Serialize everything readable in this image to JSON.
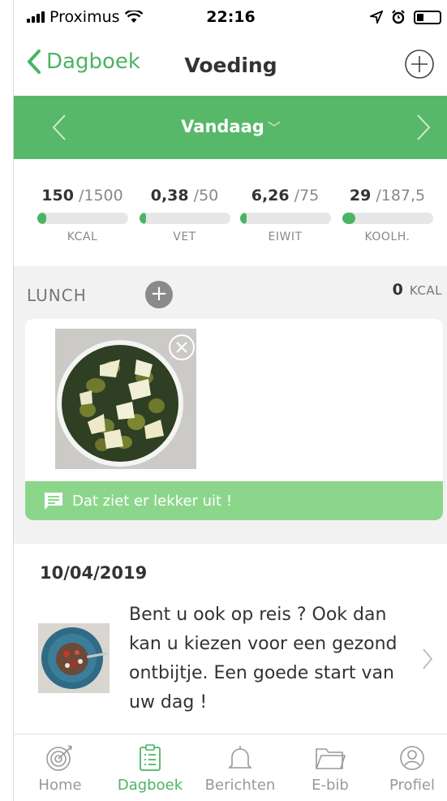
{
  "status_bar": {
    "carrier": "Proximus",
    "time": "22:16"
  },
  "nav": {
    "back_label": "Dagboek",
    "title": "Voeding"
  },
  "date_bar": {
    "label": "Vandaag"
  },
  "summary": [
    {
      "value": "150",
      "max": "/1500",
      "unit": "KCAL",
      "progress": 0.1
    },
    {
      "value": "0,38",
      "max": "/50",
      "unit": "VET",
      "progress": 0.01
    },
    {
      "value": "6,26",
      "max": "/75",
      "unit": "EIWIT",
      "progress": 0.08
    },
    {
      "value": "29",
      "max": "/187,5",
      "unit": "KOOLH.",
      "progress": 0.15
    }
  ],
  "lunch": {
    "title": "LUNCH",
    "kcal_value": "0",
    "kcal_unit": "KCAL",
    "comment": "Dat ziet er lekker uit !"
  },
  "news": {
    "date": "10/04/2019",
    "text": "Bent u ook op reis ? Ook dan kan u kiezen voor een gezond ontbijtje. Een goede start van uw dag !"
  },
  "tabs": [
    {
      "label": "Home",
      "icon": "target-icon"
    },
    {
      "label": "Dagboek",
      "icon": "clipboard-icon"
    },
    {
      "label": "Berichten",
      "icon": "bell-icon"
    },
    {
      "label": "E-bib",
      "icon": "folder-icon"
    },
    {
      "label": "Profiel",
      "icon": "user-icon"
    }
  ],
  "colors": {
    "accent": "#4bb464",
    "date_bar": "#58b86a",
    "comment_bar": "#8cd68c"
  }
}
